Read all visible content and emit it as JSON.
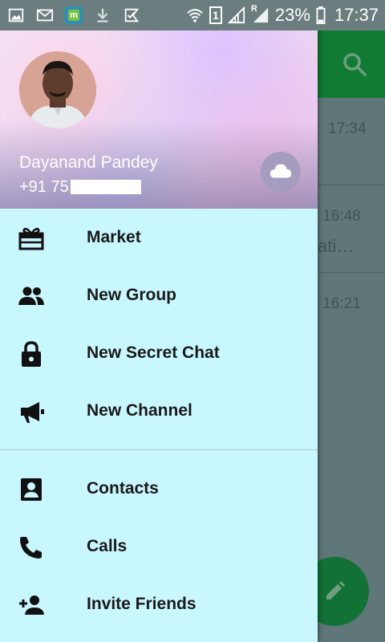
{
  "status_bar": {
    "sim_slot": "1",
    "roaming": "R",
    "battery": "23%",
    "time": "17:37"
  },
  "background_chats": {
    "times": [
      "17:34",
      "16:48",
      "16:21"
    ],
    "snippet": "ati…"
  },
  "drawer": {
    "user": {
      "name": "Dayanand Pandey",
      "phone": "+91 75"
    },
    "menu": [
      {
        "label": "Market",
        "icon": "gift-box-icon"
      },
      {
        "label": "New Group",
        "icon": "group-icon"
      },
      {
        "label": "New Secret Chat",
        "icon": "lock-icon"
      },
      {
        "label": "New Channel",
        "icon": "megaphone-icon"
      },
      {
        "label": "Contacts",
        "icon": "contact-card-icon"
      },
      {
        "label": "Calls",
        "icon": "phone-icon"
      },
      {
        "label": "Invite Friends",
        "icon": "add-person-icon"
      }
    ]
  },
  "colors": {
    "drawer_bg": "#c9f7ff",
    "toolbar": "#117a33",
    "fab": "#127236"
  }
}
